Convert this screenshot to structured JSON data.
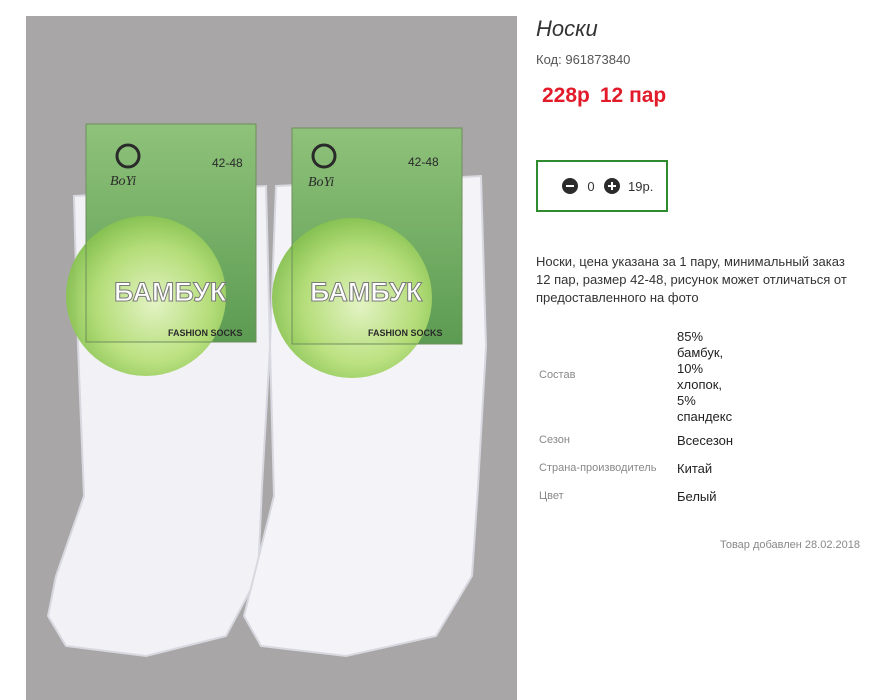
{
  "product": {
    "title": "Носки",
    "code_label": "Код:",
    "code_value": "961873840",
    "price": "228р",
    "pack": "12 пар",
    "quantity": "0",
    "quantity_price": "19р.",
    "description": "Носки, цена указана за 1 пару, минимальный заказ 12 пар, размер 42-48, рисунок может отличаться от предоставленного на фото",
    "added": "Товар добавлен 28.02.2018"
  },
  "image": {
    "brand": "BoYi",
    "size": "42-48",
    "material": "БАМБУК",
    "tagline": "FASHION SOCKS"
  },
  "properties": [
    {
      "name": "Состав",
      "lines": [
        "85%",
        "бамбук,",
        "10%",
        "хлопок,",
        "5%",
        "спандекс"
      ]
    },
    {
      "name": "Сезон",
      "value": "Всесезон"
    },
    {
      "name": "Страна-производитель",
      "value": "Китай"
    },
    {
      "name": "Цвет",
      "value": "Белый"
    }
  ],
  "colors": {
    "price": "#e21b2b",
    "qty_border": "#2e8b2e",
    "photo_bg": "#a9a6a7"
  }
}
